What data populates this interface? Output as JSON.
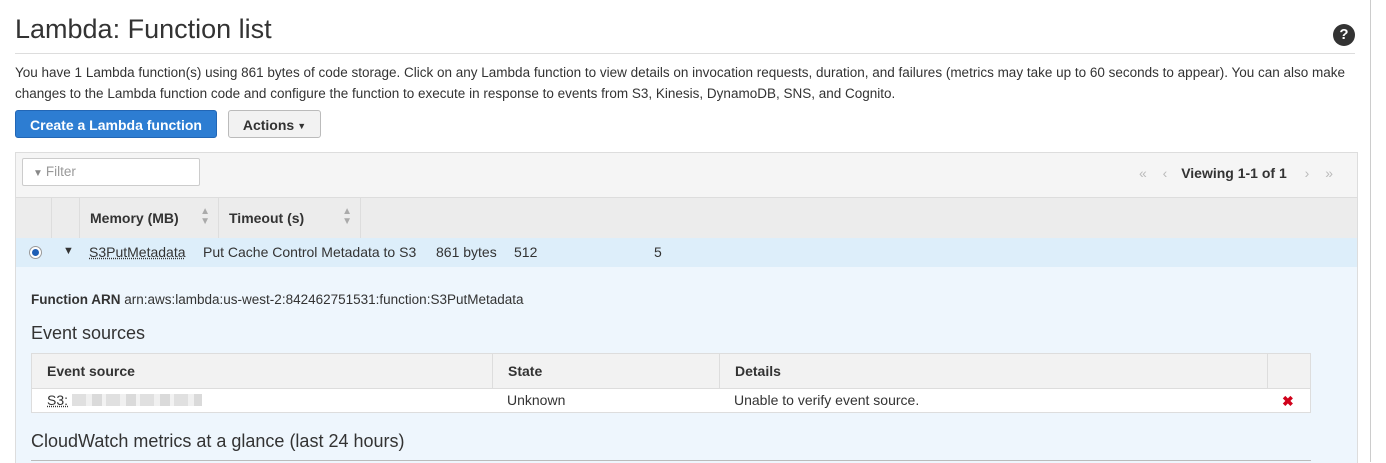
{
  "header": {
    "title": "Lambda: Function list",
    "help_icon": "?"
  },
  "intro": {
    "text": "You have 1 Lambda function(s) using 861 bytes of code storage. Click on any Lambda function to view details on invocation requests, duration, and failures (metrics may take up to 60 seconds to appear). You can also make changes to the Lambda function code and configure the function to execute in response to events from S3, Kinesis, DynamoDB, SNS, and Cognito."
  },
  "toolbar": {
    "create_label": "Create a Lambda function",
    "actions_label": "Actions"
  },
  "table": {
    "filter_placeholder": "Filter",
    "pager": {
      "first_icon": "«",
      "prev_icon": "‹",
      "text": "Viewing 1-1 of 1",
      "next_icon": "›",
      "last_icon": "»"
    },
    "columns": {
      "memory": "Memory (MB)",
      "timeout": "Timeout (s)"
    },
    "rows": [
      {
        "name": "S3PutMetadata",
        "description": "Put Cache Control Metadata to S3",
        "code_size": "861 bytes",
        "memory": "512",
        "timeout": "5"
      }
    ]
  },
  "details": {
    "arn_label": "Function ARN",
    "arn_value": "arn:aws:lambda:us-west-2:842462751531:function:S3PutMetadata",
    "event_sources_title": "Event sources",
    "event_columns": {
      "source": "Event source",
      "state": "State",
      "details": "Details"
    },
    "event_rows": [
      {
        "source": "S3:",
        "state": "Unknown",
        "details": "Unable to verify event source."
      }
    ],
    "cloudwatch_title": "CloudWatch metrics at a glance (last 24 hours)"
  },
  "colors": {
    "primary_button": "#2d7dd2",
    "selected_row": "#ddeefa",
    "delete_icon": "#d0021b"
  }
}
